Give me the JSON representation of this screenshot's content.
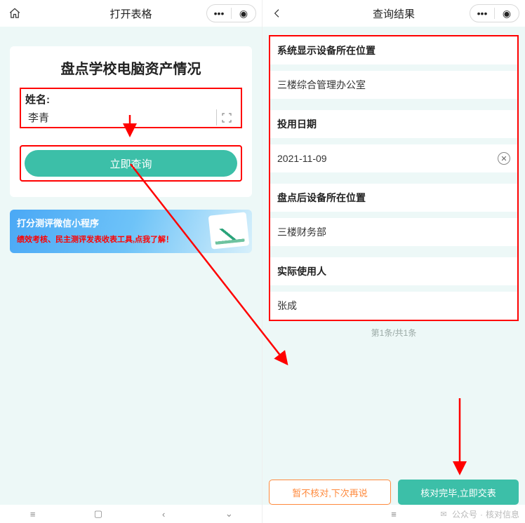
{
  "left": {
    "topbar": {
      "title": "打开表格"
    },
    "card": {
      "heading": "盘点学校电脑资产情况",
      "name_label": "姓名:",
      "name_value": "李青",
      "query_label": "立即查询"
    },
    "promo": {
      "title": "打分测评微信小程序",
      "subtitle": "绩效考核、民主测评发表收表工具,点我了解！"
    }
  },
  "right": {
    "topbar": {
      "title": "查询结果"
    },
    "fields": [
      {
        "label": "系统显示设备所在位置",
        "value": "三楼综合管理办公室",
        "clearable": false
      },
      {
        "label": "投用日期",
        "value": "2021-11-09",
        "clearable": true
      },
      {
        "label": "盘点后设备所在位置",
        "value": "三楼财务部",
        "clearable": false
      },
      {
        "label": "实际使用人",
        "value": "张成",
        "clearable": false
      }
    ],
    "pager": "第1条/共1条",
    "actions": {
      "later": "暂不核对,下次再说",
      "submit": "核对完毕,立即交表"
    }
  },
  "watermark": {
    "prefix": "公众号",
    "sep": "·",
    "name": "核对信息"
  }
}
